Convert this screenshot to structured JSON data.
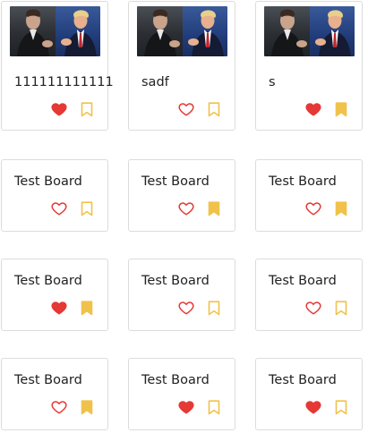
{
  "colors": {
    "heart": "#e53935",
    "bookmark": "#f0c24b",
    "border": "#dcdcdc"
  },
  "icons": {
    "like": "heart-icon",
    "save": "bookmark-icon",
    "thumbnail": "photo-thumbnail"
  },
  "cards": [
    {
      "title": "111111111111",
      "has_image": true,
      "liked": true,
      "saved": false
    },
    {
      "title": "sadf",
      "has_image": true,
      "liked": false,
      "saved": false
    },
    {
      "title": "s",
      "has_image": true,
      "liked": true,
      "saved": true
    },
    {
      "title": "Test Board",
      "has_image": false,
      "liked": false,
      "saved": false
    },
    {
      "title": "Test Board",
      "has_image": false,
      "liked": false,
      "saved": true
    },
    {
      "title": "Test Board",
      "has_image": false,
      "liked": false,
      "saved": true
    },
    {
      "title": "Test Board",
      "has_image": false,
      "liked": true,
      "saved": true
    },
    {
      "title": "Test Board",
      "has_image": false,
      "liked": false,
      "saved": false
    },
    {
      "title": "Test Board",
      "has_image": false,
      "liked": false,
      "saved": false
    },
    {
      "title": "Test Board",
      "has_image": false,
      "liked": false,
      "saved": true
    },
    {
      "title": "Test Board",
      "has_image": false,
      "liked": true,
      "saved": false
    },
    {
      "title": "Test Board",
      "has_image": false,
      "liked": true,
      "saved": false
    }
  ]
}
